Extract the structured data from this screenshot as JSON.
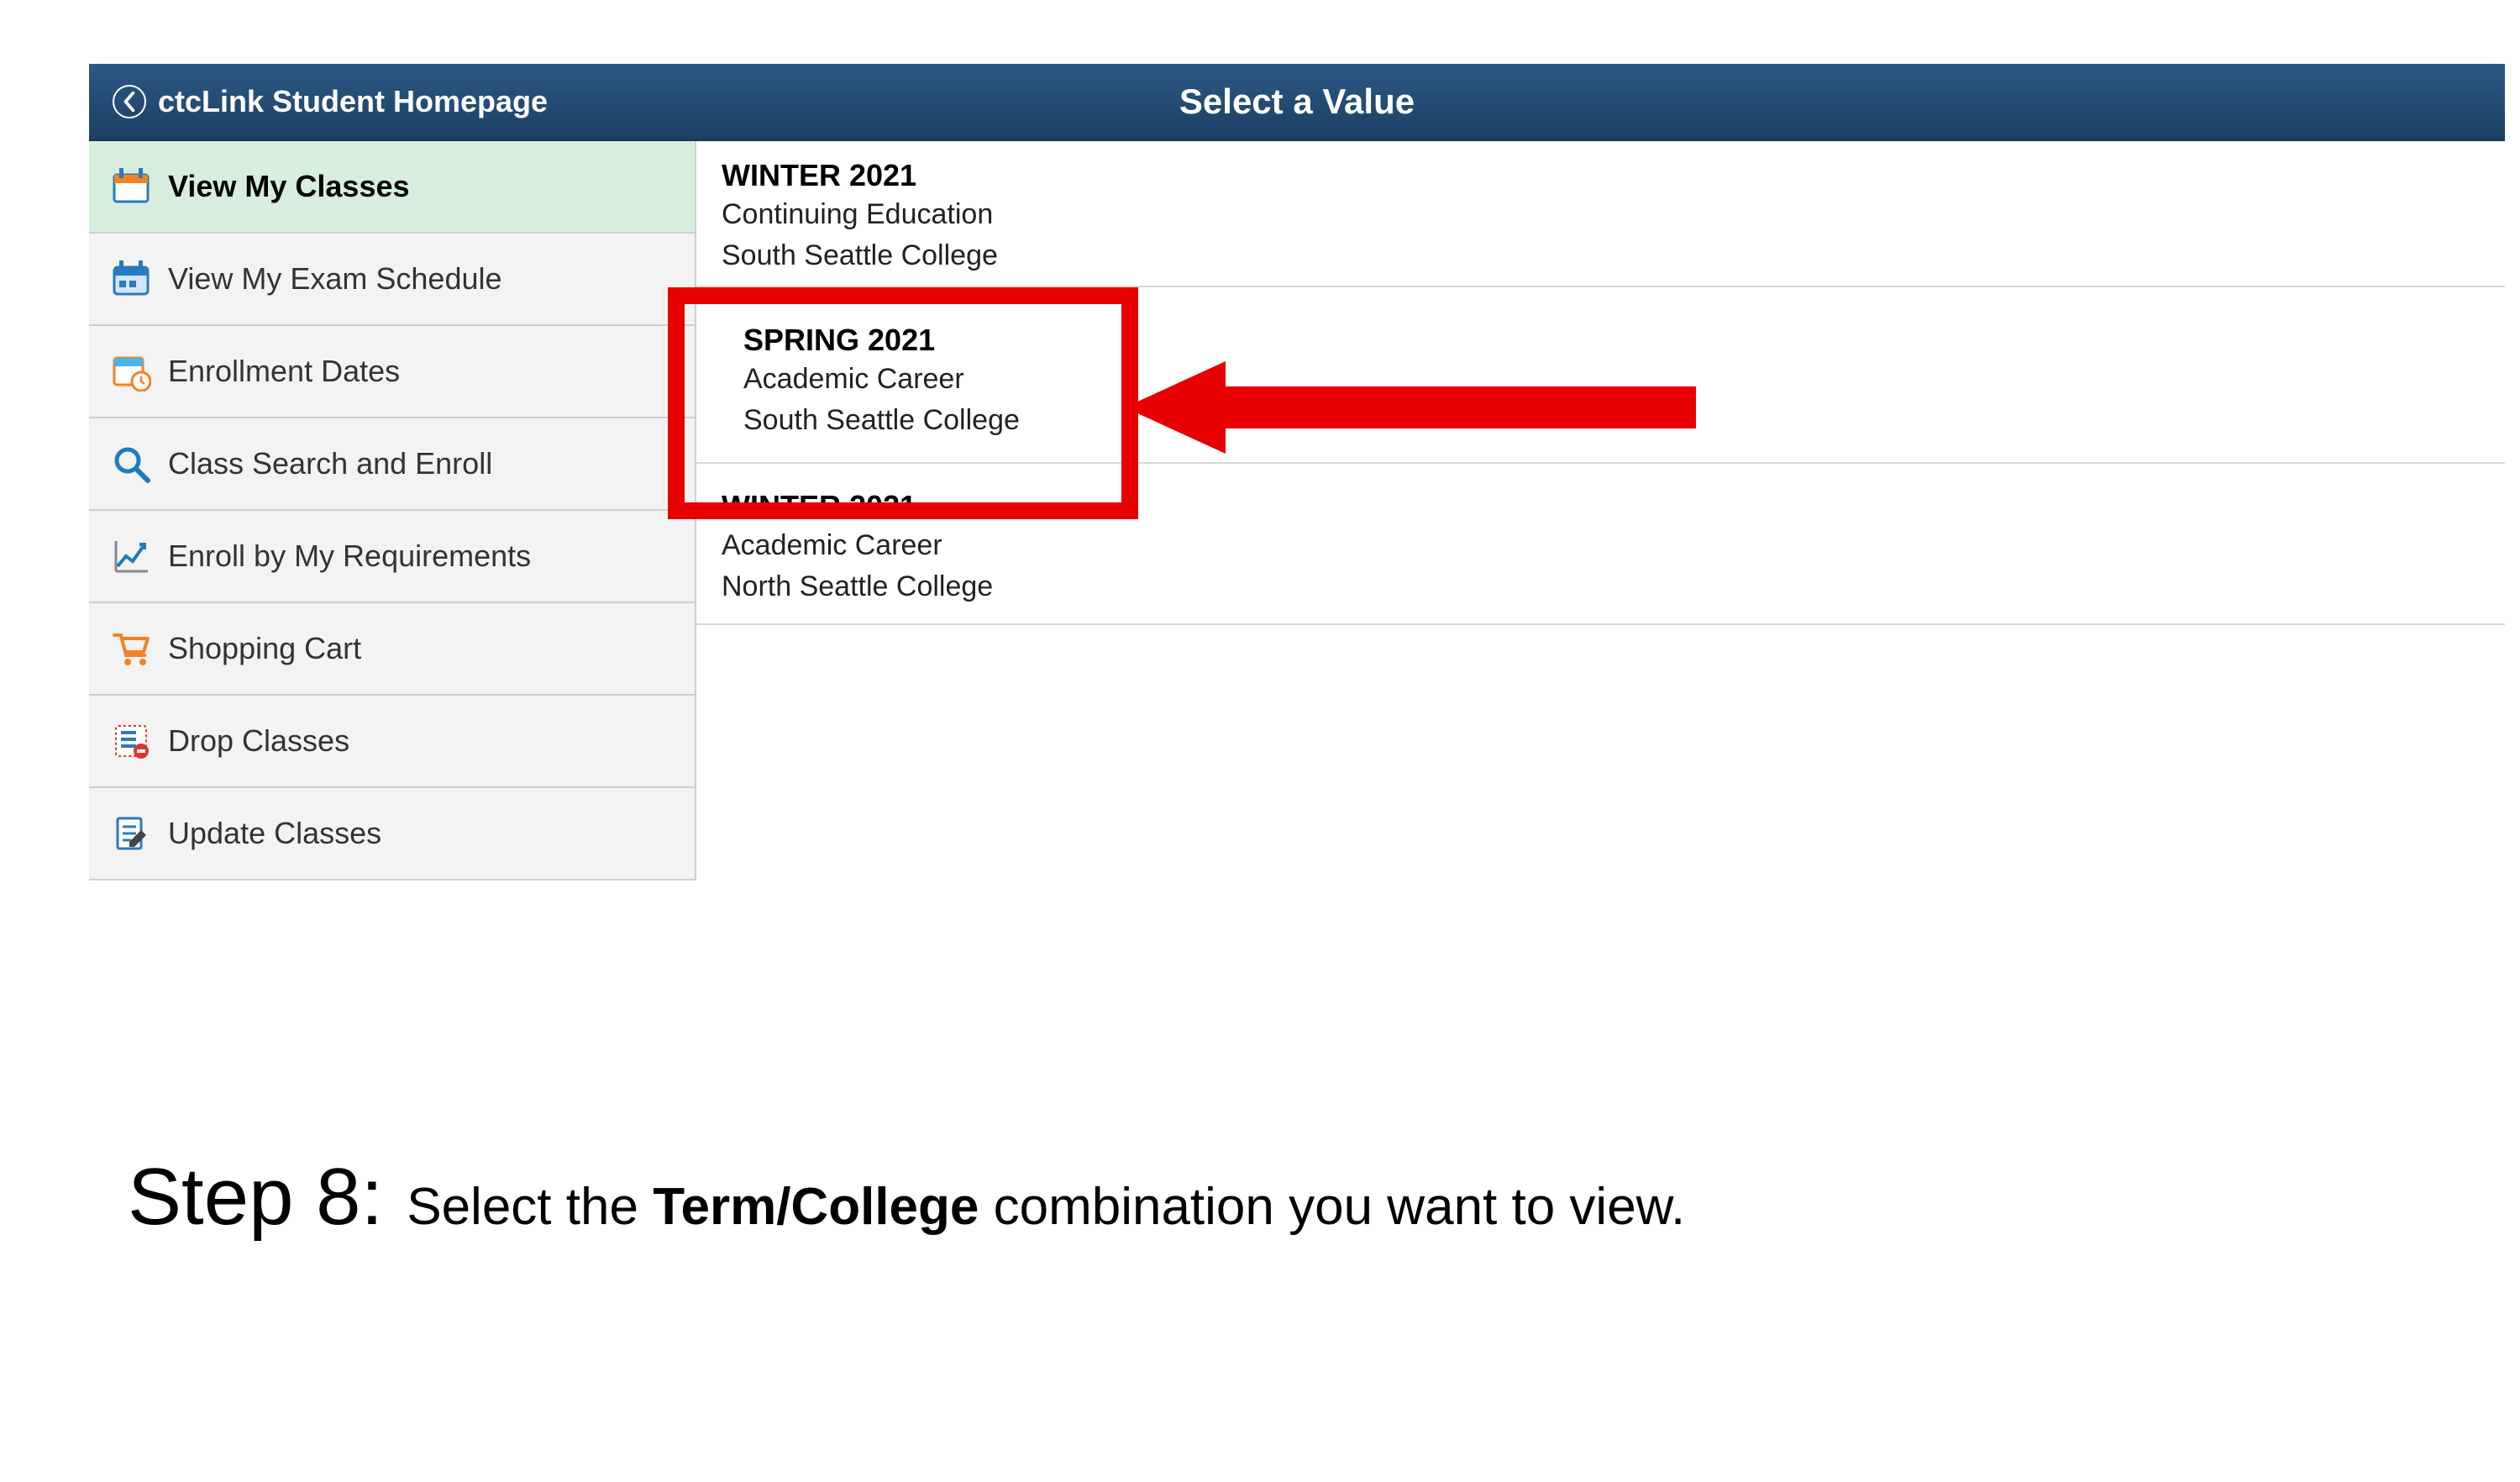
{
  "header": {
    "back_label": "ctcLink Student Homepage",
    "title": "Select a Value"
  },
  "sidebar": {
    "items": [
      {
        "label": "View My Classes",
        "icon": "calendar-icon",
        "active": true
      },
      {
        "label": "View My Exam Schedule",
        "icon": "schedule-icon",
        "active": false
      },
      {
        "label": "Enrollment Dates",
        "icon": "clock-calendar-icon",
        "active": false
      },
      {
        "label": "Class Search and Enroll",
        "icon": "search-icon",
        "active": false
      },
      {
        "label": "Enroll by My Requirements",
        "icon": "chart-line-icon",
        "active": false
      },
      {
        "label": "Shopping Cart",
        "icon": "cart-icon",
        "active": false
      },
      {
        "label": "Drop Classes",
        "icon": "list-remove-icon",
        "active": false
      },
      {
        "label": "Update Classes",
        "icon": "edit-doc-icon",
        "active": false
      }
    ]
  },
  "values": [
    {
      "term": "WINTER 2021",
      "career": "Continuing Education",
      "college": "South Seattle College",
      "highlighted": false
    },
    {
      "term": "SPRING 2021",
      "career": "Academic Career",
      "college": "South Seattle College",
      "highlighted": true
    },
    {
      "term": "WINTER 2021",
      "career": "Academic Career",
      "college": "North Seattle College",
      "highlighted": false
    }
  ],
  "annotation": {
    "step_label": "Step 8:",
    "text_before": "Select the ",
    "text_bold": "Term/College",
    "text_after": " combination you want to view.",
    "highlight_color": "#e60000"
  }
}
